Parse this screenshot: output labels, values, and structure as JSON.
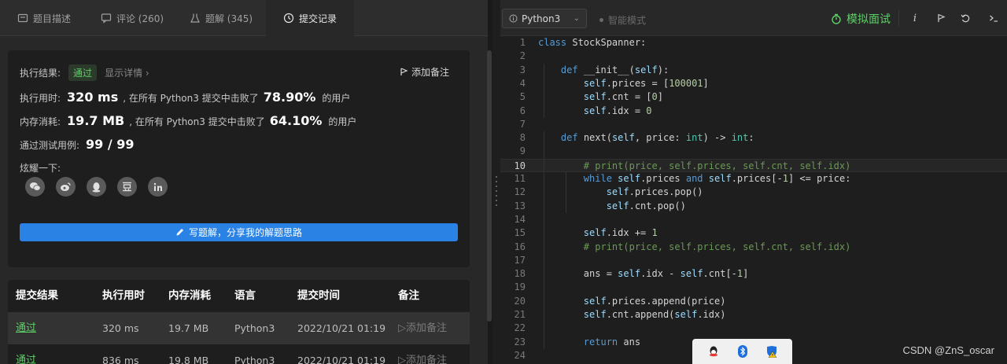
{
  "tabs": [
    {
      "label": "题目描述",
      "icon": "document-icon"
    },
    {
      "label": "评论 (260)",
      "icon": "comment-icon"
    },
    {
      "label": "题解 (345)",
      "icon": "flask-icon"
    },
    {
      "label": "提交记录",
      "icon": "clock-icon"
    }
  ],
  "result": {
    "status_label": "执行结果:",
    "status_value": "通过",
    "details_link": "显示详情 ›",
    "add_note": "添加备注",
    "runtime_label": "执行用时:",
    "runtime_value": "320 ms",
    "runtime_mid": ", 在所有 Python3 提交中击败了",
    "runtime_percent": "78.90%",
    "runtime_tail": "的用户",
    "memory_label": "内存消耗:",
    "memory_value": "19.7 MB",
    "memory_mid": ", 在所有 Python3 提交中击败了",
    "memory_percent": "64.10%",
    "memory_tail": "的用户",
    "tests_label": "通过测试用例:",
    "tests_value": "99 / 99",
    "share_label": "炫耀一下:",
    "share_icons": [
      "wechat-icon",
      "weibo-icon",
      "qq-icon",
      "douban-icon",
      "linkedin-icon"
    ],
    "write_solution": "写题解，分享我的解题思路"
  },
  "submissions": {
    "headers": [
      "提交结果",
      "执行用时",
      "内存消耗",
      "语言",
      "提交时间",
      "备注"
    ],
    "rows": [
      {
        "status": "通过",
        "runtime": "320 ms",
        "memory": "19.7 MB",
        "language": "Python3",
        "time": "2022/10/21 01:19",
        "note": "添加备注"
      },
      {
        "status": "通过",
        "runtime": "836 ms",
        "memory": "19.8 MB",
        "language": "Python3",
        "time": "2022/10/21 01:19",
        "note": "添加备注"
      }
    ]
  },
  "editor": {
    "language": "Python3",
    "smart_mode": "智能模式",
    "mock_interview": "模拟面试",
    "current_line": 10,
    "lines": [
      "class StockSpanner:",
      "",
      "    def __init__(self):",
      "        self.prices = [100001]",
      "        self.cnt = [0]",
      "        self.idx = 0",
      "",
      "    def next(self, price: int) -> int:",
      "",
      "        # print(price, self.prices, self.cnt, self.idx)",
      "        while self.prices and self.prices[-1] <= price:",
      "            self.prices.pop()",
      "            self.cnt.pop()",
      "",
      "        self.idx += 1",
      "        # print(price, self.prices, self.cnt, self.idx)",
      "",
      "        ans = self.idx - self.cnt[-1]",
      "",
      "        self.prices.append(price)",
      "        self.cnt.append(self.idx)",
      "",
      "        return ans",
      ""
    ]
  },
  "watermark": "CSDN @ZnS_oscar",
  "colors": {
    "accent_green": "#5fd068",
    "button_blue": "#2a82e4"
  }
}
